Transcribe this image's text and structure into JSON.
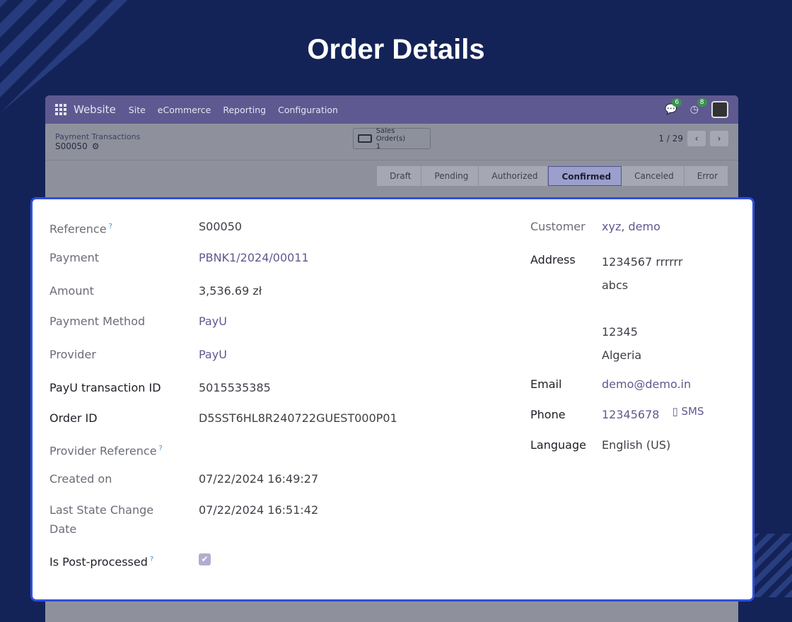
{
  "headline": "Order Details",
  "navbar": {
    "brand": "Website",
    "menus": [
      "Site",
      "eCommerce",
      "Reporting",
      "Configuration"
    ],
    "messages_count": "6",
    "activities_count": "8"
  },
  "control": {
    "parent_crumb": "Payment Transactions",
    "current_record": "S00050",
    "stat_button_label": "Sales Order(s)",
    "stat_button_count": "1",
    "pager_value": "1 / 29"
  },
  "stages": [
    "Draft",
    "Pending",
    "Authorized",
    "Confirmed",
    "Canceled",
    "Error"
  ],
  "active_stage": "Confirmed",
  "left_fields": {
    "reference": {
      "label": "Reference",
      "value": "S00050"
    },
    "payment": {
      "label": "Payment",
      "value": "PBNK1/2024/00011"
    },
    "amount": {
      "label": "Amount",
      "value": "3,536.69 zł"
    },
    "payment_method": {
      "label": "Payment Method",
      "value": "PayU"
    },
    "provider": {
      "label": "Provider",
      "value": "PayU"
    },
    "payu_tx": {
      "label": "PayU transaction ID",
      "value": "5015535385"
    },
    "order_id": {
      "label": "Order ID",
      "value": "D5SST6HL8R240722GUEST000P01"
    },
    "provider_ref": {
      "label": "Provider Reference",
      "value": ""
    },
    "created_on": {
      "label": "Created on",
      "value": "07/22/2024 16:49:27"
    },
    "last_state_change_l1": "Last State Change",
    "last_state_change_l2": "Date",
    "last_state_change_value": "07/22/2024 16:51:42",
    "post_processed": {
      "label": "Is Post-processed",
      "checked": true
    }
  },
  "right_fields": {
    "customer": {
      "label": "Customer",
      "value": "xyz, demo"
    },
    "address_label": "Address",
    "address_lines": [
      "1234567 rrrrrr",
      "abcs",
      "12345",
      "Algeria"
    ],
    "email": {
      "label": "Email",
      "value": "demo@demo.in"
    },
    "phone": {
      "label": "Phone",
      "value": "12345678",
      "sms": "SMS"
    },
    "language": {
      "label": "Language",
      "value": "English (US)"
    }
  },
  "tooltip_mark": "?"
}
